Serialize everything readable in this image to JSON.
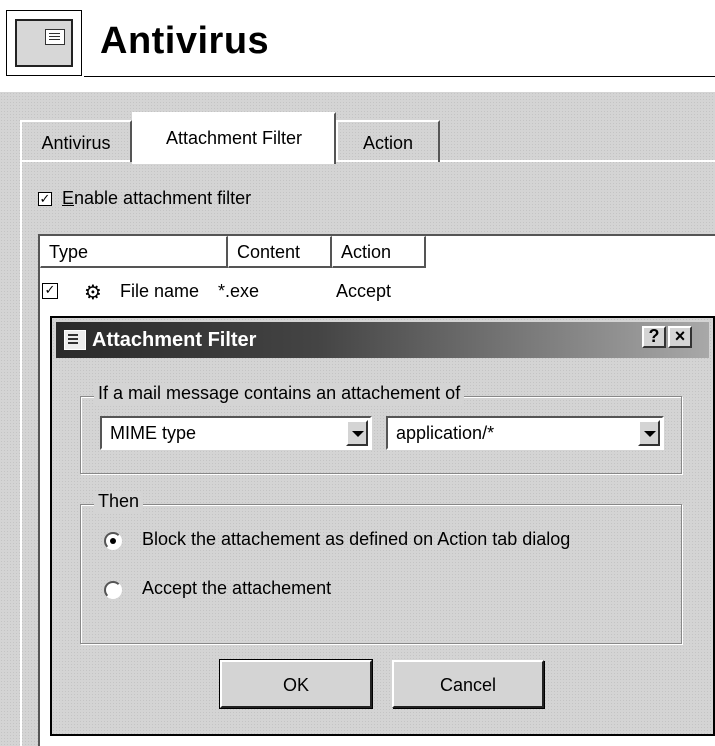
{
  "header": {
    "title": "Antivirus",
    "icon": "antivirus-settings-icon"
  },
  "tabs": [
    {
      "label": "Antivirus",
      "selected": false
    },
    {
      "label": "Attachment Filter",
      "selected": true
    },
    {
      "label": "Action",
      "selected": false
    }
  ],
  "enable_filter": {
    "label_prefix": "E",
    "label_rest": "nable attachment filter",
    "checked": true
  },
  "list": {
    "columns": [
      "Type",
      "Content",
      "Action"
    ],
    "rows": [
      {
        "checked": true,
        "type": "File name",
        "content": "*.exe",
        "action": "Accept",
        "icon": "file-type-icon"
      }
    ]
  },
  "dialog": {
    "title": "Attachment Filter",
    "help_label": "?",
    "close_label": "×",
    "condition_group": {
      "legend": "If a mail message contains an attachement of",
      "type_select": "MIME type",
      "value_select": "application/*"
    },
    "then_group": {
      "legend": "Then",
      "options": [
        {
          "label": "Block the attachement as defined on Action tab dialog",
          "selected": true
        },
        {
          "label": "Accept the attachement",
          "selected": false
        }
      ]
    },
    "ok_label": "OK",
    "cancel_label": "Cancel"
  }
}
